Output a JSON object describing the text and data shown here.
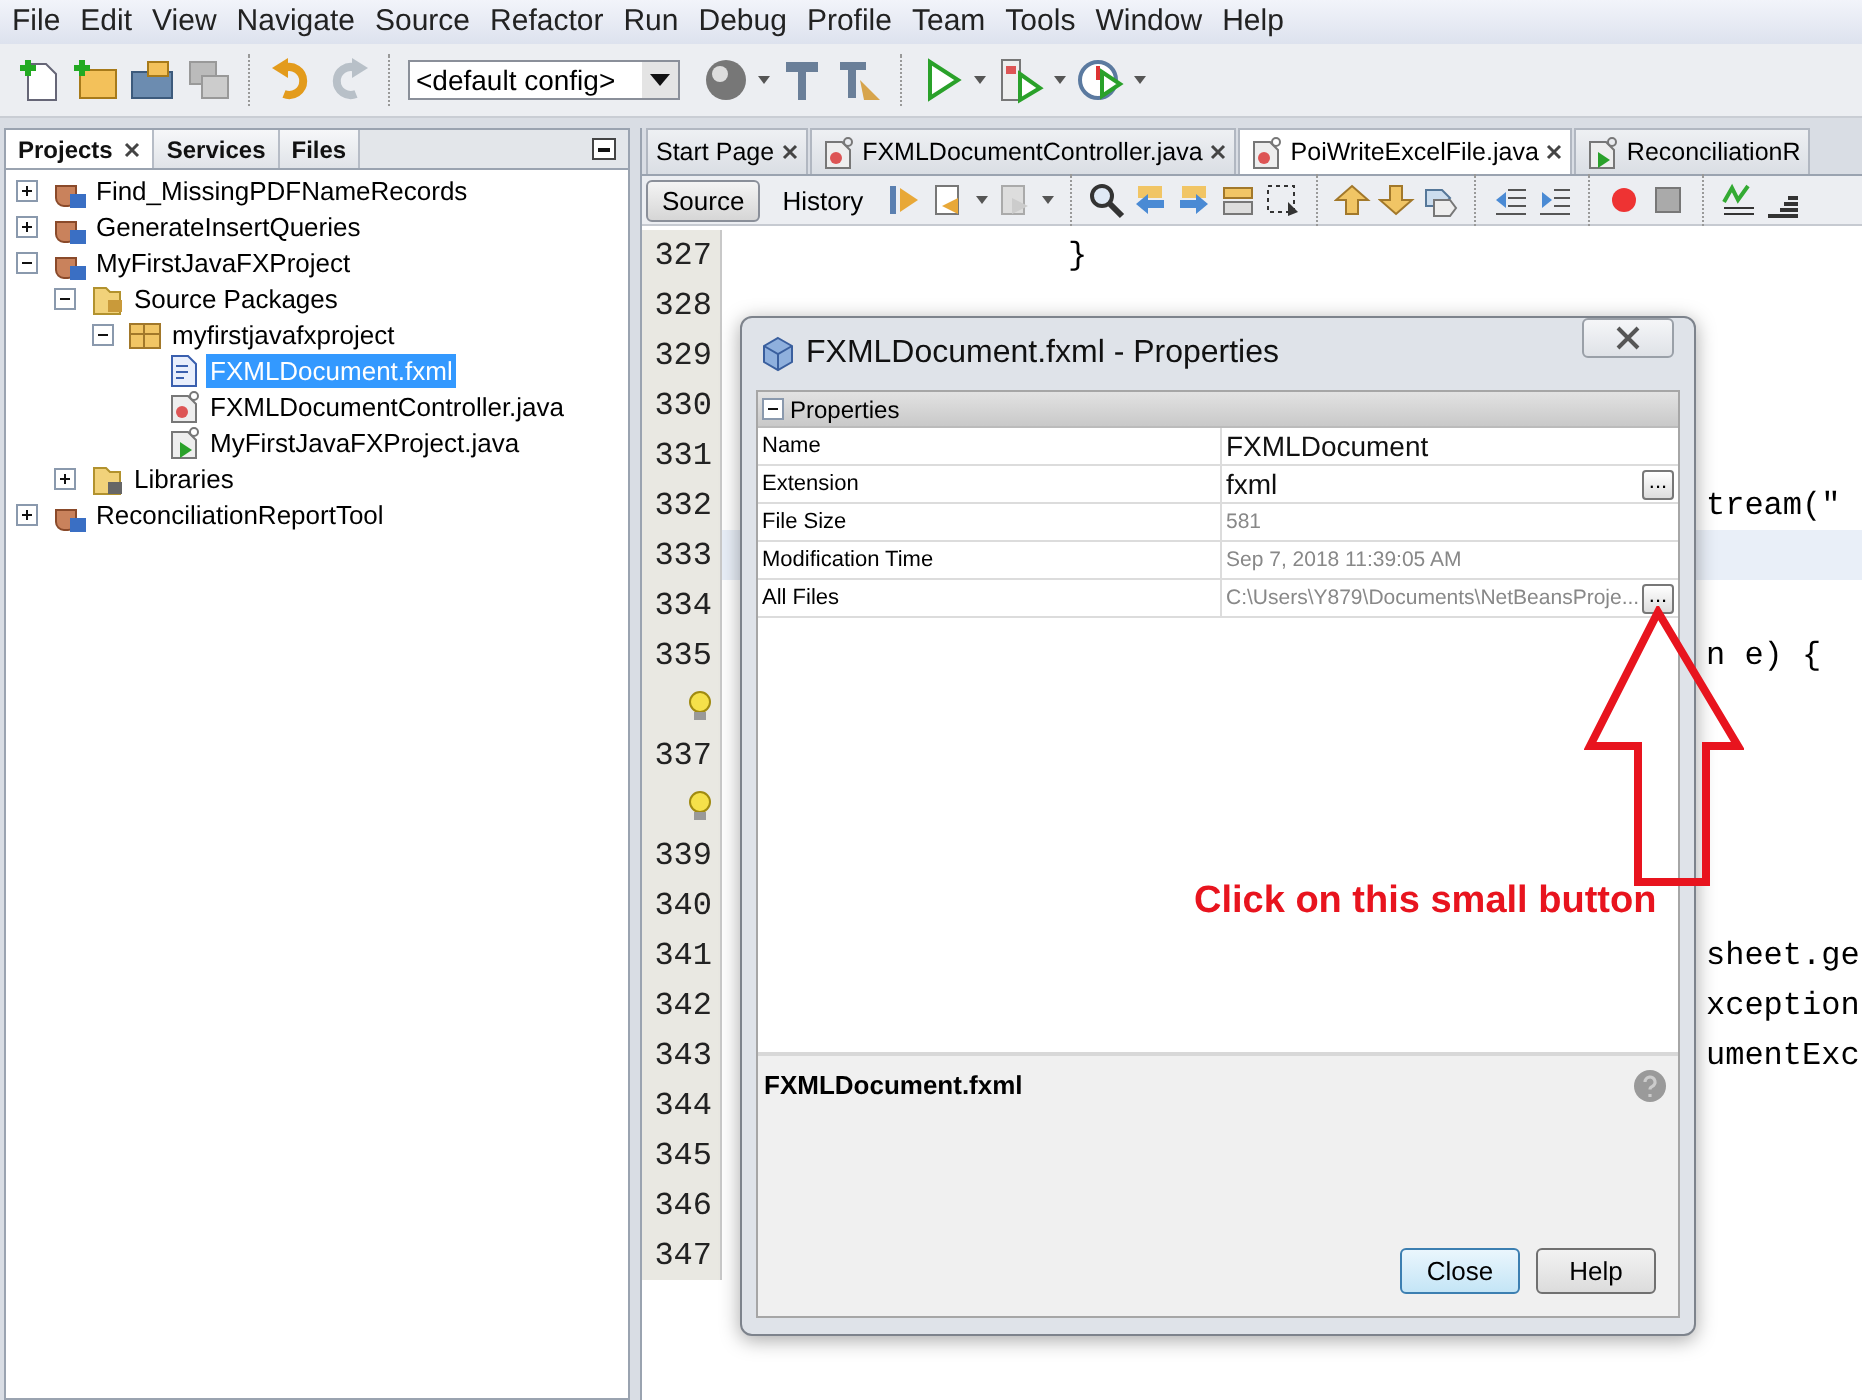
{
  "menu": [
    "File",
    "Edit",
    "View",
    "Navigate",
    "Source",
    "Refactor",
    "Run",
    "Debug",
    "Profile",
    "Team",
    "Tools",
    "Window",
    "Help"
  ],
  "toolbar": {
    "config": "<default config>"
  },
  "projects_panel": {
    "tabs": [
      {
        "label": "Projects",
        "selected": true,
        "closable": true
      },
      {
        "label": "Services",
        "selected": false,
        "closable": false
      },
      {
        "label": "Files",
        "selected": false,
        "closable": false
      }
    ],
    "tree": [
      {
        "label": "Find_MissingPDFNameRecords",
        "kind": "project",
        "expanded": false,
        "selected": false
      },
      {
        "label": "GenerateInsertQueries",
        "kind": "project",
        "expanded": false,
        "selected": false
      },
      {
        "label": "MyFirstJavaFXProject",
        "kind": "project",
        "expanded": true,
        "selected": false,
        "children": [
          {
            "label": "Source Packages",
            "kind": "folder",
            "expanded": true,
            "selected": false,
            "children": [
              {
                "label": "myfirstjavafxproject",
                "kind": "package",
                "expanded": true,
                "selected": false,
                "children": [
                  {
                    "label": "FXMLDocument.fxml",
                    "kind": "fxml",
                    "selected": true
                  },
                  {
                    "label": "FXMLDocumentController.java",
                    "kind": "java",
                    "selected": false
                  },
                  {
                    "label": "MyFirstJavaFXProject.java",
                    "kind": "main-java",
                    "selected": false
                  }
                ]
              }
            ]
          },
          {
            "label": "Libraries",
            "kind": "libraries",
            "expanded": false,
            "selected": false
          }
        ]
      },
      {
        "label": "ReconciliationReportTool",
        "kind": "project",
        "expanded": false,
        "selected": false
      }
    ]
  },
  "editor": {
    "tabs": [
      {
        "label": "Start Page",
        "kind": "page",
        "selected": false,
        "closable": true
      },
      {
        "label": "FXMLDocumentController.java",
        "kind": "java",
        "selected": false,
        "closable": true
      },
      {
        "label": "PoiWriteExcelFile.java",
        "kind": "java",
        "selected": true,
        "closable": true
      },
      {
        "label": "ReconciliationR",
        "kind": "main-java",
        "selected": false,
        "closable": false
      }
    ],
    "views": [
      {
        "label": "Source",
        "selected": true
      },
      {
        "label": "History",
        "selected": false
      }
    ],
    "lines": [
      {
        "number": "327",
        "kind": "code",
        "text": "}",
        "current": false
      },
      {
        "number": "328",
        "kind": "blank",
        "current": false
      },
      {
        "number": "329",
        "kind": "blank",
        "current": false
      },
      {
        "number": "330",
        "kind": "blank",
        "current": false
      },
      {
        "number": "331",
        "kind": "blank",
        "current": false
      },
      {
        "number": "332",
        "kind": "tail",
        "text": "tream(\"",
        "current": false
      },
      {
        "number": "333",
        "kind": "blank",
        "current": true
      },
      {
        "number": "334",
        "kind": "blank",
        "current": false
      },
      {
        "number": "335",
        "kind": "tail",
        "text": "n e) {",
        "current": false
      },
      {
        "kind": "hint",
        "current": false
      },
      {
        "number": "337",
        "kind": "blank",
        "current": false
      },
      {
        "kind": "hint",
        "current": false
      },
      {
        "number": "339",
        "kind": "blank",
        "current": false
      },
      {
        "number": "340",
        "kind": "blank",
        "current": false
      },
      {
        "number": "341",
        "kind": "tail",
        "text": "sheet.ge",
        "current": false
      },
      {
        "number": "342",
        "kind": "tail",
        "text": "xception",
        "current": false
      },
      {
        "number": "343",
        "kind": "tail",
        "text": "umentExc",
        "current": false
      },
      {
        "number": "344",
        "kind": "blank",
        "current": false
      },
      {
        "number": "345",
        "kind": "blank",
        "current": false
      },
      {
        "number": "346",
        "kind": "blank",
        "current": false
      },
      {
        "number": "347",
        "kind": "blank",
        "current": false
      }
    ]
  },
  "dialog": {
    "title": "FXMLDocument.fxml - Properties",
    "section": "Properties",
    "section_expanded": true,
    "properties": [
      {
        "name": "Name",
        "value": "FXMLDocument",
        "editable": true
      },
      {
        "name": "Extension",
        "value": "fxml",
        "editable": true,
        "button": "..."
      },
      {
        "name": "File Size",
        "value": "581",
        "editable": false
      },
      {
        "name": "Modification Time",
        "value": "Sep 7, 2018 11:39:05 AM",
        "editable": false
      },
      {
        "name": "All Files",
        "value": "C:\\Users\\Y879\\Documents\\NetBeansProje...",
        "editable": false,
        "button": "..."
      }
    ],
    "description_title": "FXMLDocument.fxml",
    "buttons": [
      {
        "label": "Close",
        "default": true
      },
      {
        "label": "Help",
        "default": false
      }
    ]
  },
  "annotation": {
    "text": "Click on this small button"
  }
}
